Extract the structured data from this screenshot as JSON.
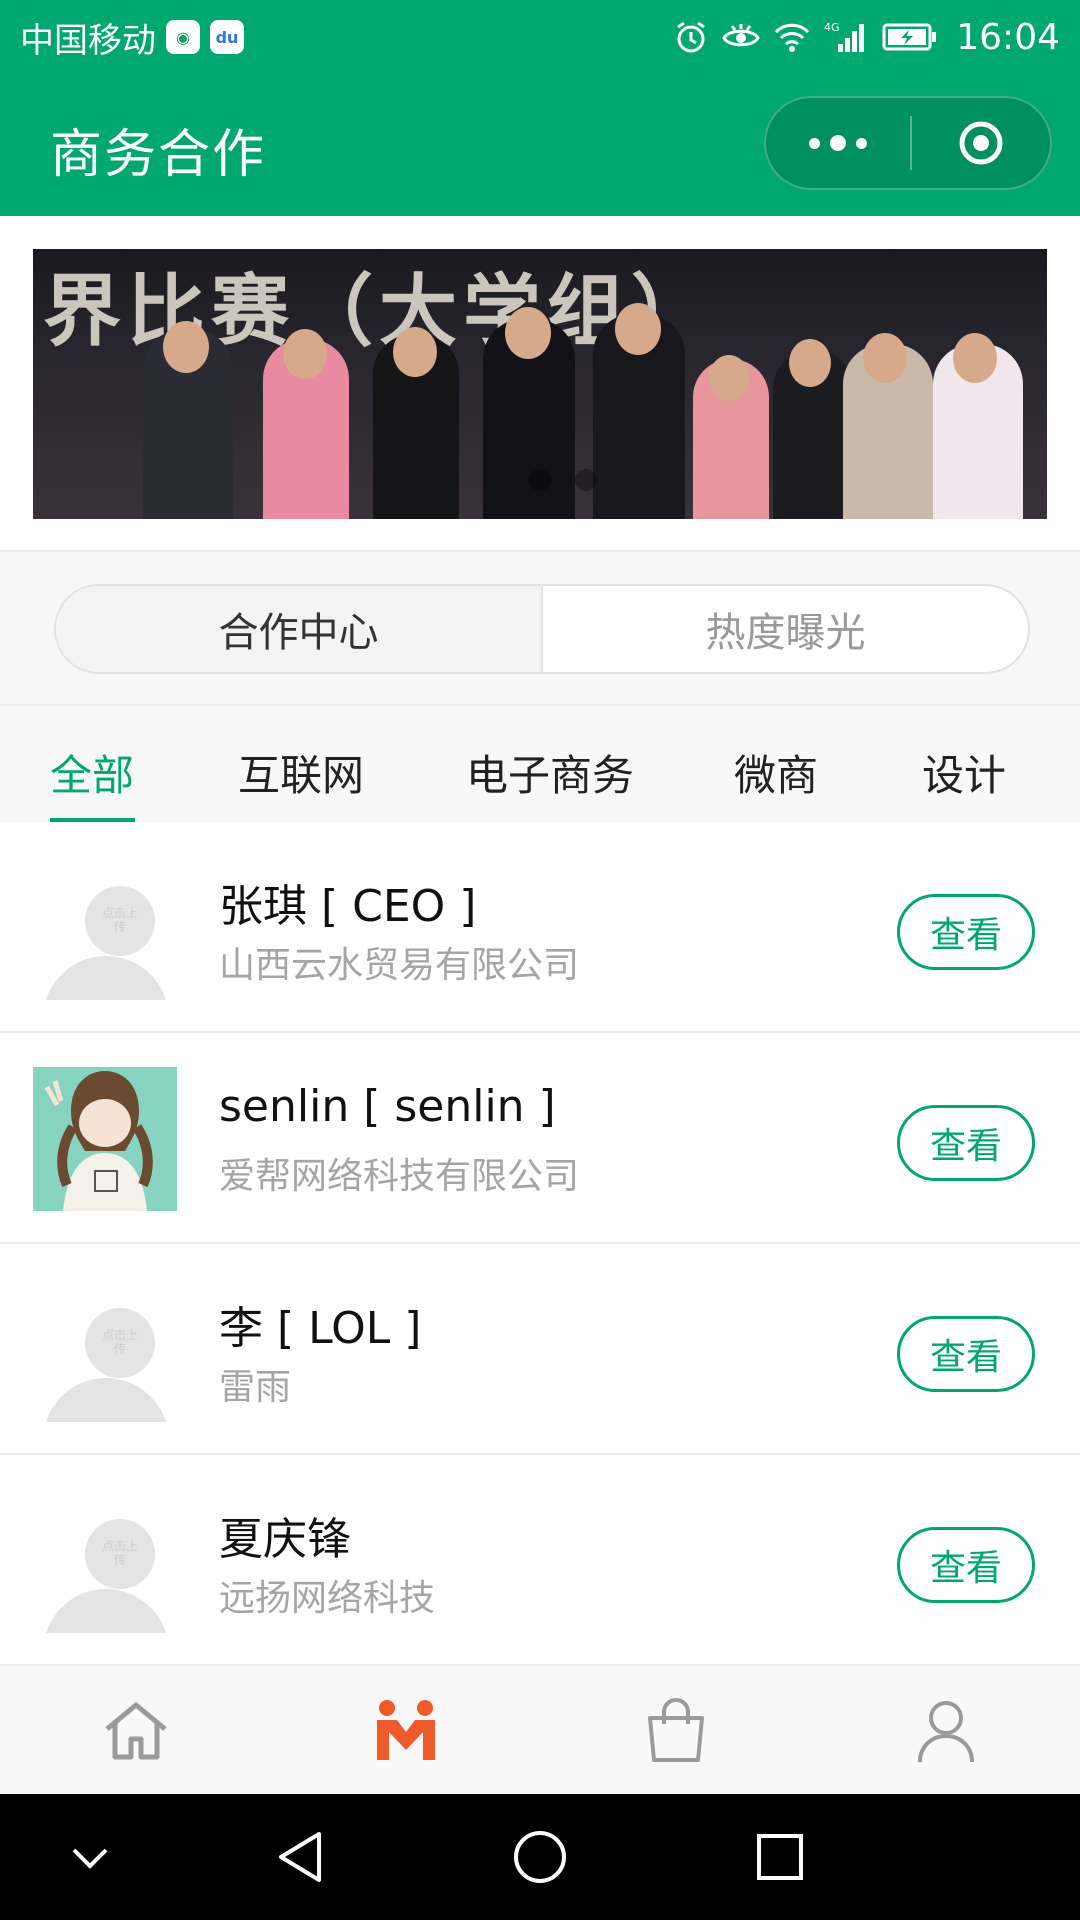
{
  "status_bar": {
    "carrier": "中国移动",
    "time": "16:04",
    "network": "4G",
    "icons": [
      "app-icon-1",
      "baidu-app-icon",
      "alarm-icon",
      "eye-icon",
      "wifi-icon",
      "signal-icon",
      "battery-charging-icon"
    ]
  },
  "header": {
    "title": "商务合作",
    "icons": [
      "more-dots-icon",
      "close-target-icon"
    ]
  },
  "banner": {
    "overlay_text": "界比赛（大学组）",
    "slide_count": 3,
    "active_slide": 1
  },
  "segment": {
    "tabs": [
      {
        "label": "合作中心",
        "active": true
      },
      {
        "label": "热度曝光",
        "active": false
      }
    ]
  },
  "categories": {
    "items": [
      {
        "label": "全部",
        "active": true
      },
      {
        "label": "互联网",
        "active": false
      },
      {
        "label": "电子商务",
        "active": false
      },
      {
        "label": "微商",
        "active": false
      },
      {
        "label": "设计",
        "active": false
      }
    ]
  },
  "list": {
    "placeholder_tip": "点击上传",
    "items": [
      {
        "name": "张琪 [ CEO ]",
        "company": "山西云水贸易有限公司",
        "avatar": "placeholder",
        "button": "查看"
      },
      {
        "name": "senlin [ senlin ]",
        "company": "爱帮网络科技有限公司",
        "avatar": "photo",
        "button": "查看"
      },
      {
        "name": "李 [ LOL ]",
        "company": "雷雨",
        "avatar": "placeholder",
        "button": "查看"
      },
      {
        "name": "夏庆锋",
        "company": "远扬网络科技",
        "avatar": "placeholder",
        "button": "查看"
      }
    ]
  },
  "tabbar": {
    "items": [
      {
        "icon": "home-icon",
        "active": false
      },
      {
        "icon": "cooperation-icon",
        "active": true
      },
      {
        "icon": "shopping-bag-icon",
        "active": false
      },
      {
        "icon": "user-profile-icon",
        "active": false
      }
    ]
  },
  "android_nav": {
    "icons": [
      "chevron-down-icon",
      "back-triangle-icon",
      "home-circle-icon",
      "recents-square-icon"
    ]
  },
  "colors": {
    "brand": "#00a870",
    "tab_active": "#f05a2a",
    "muted_text": "#a5a5a5"
  }
}
